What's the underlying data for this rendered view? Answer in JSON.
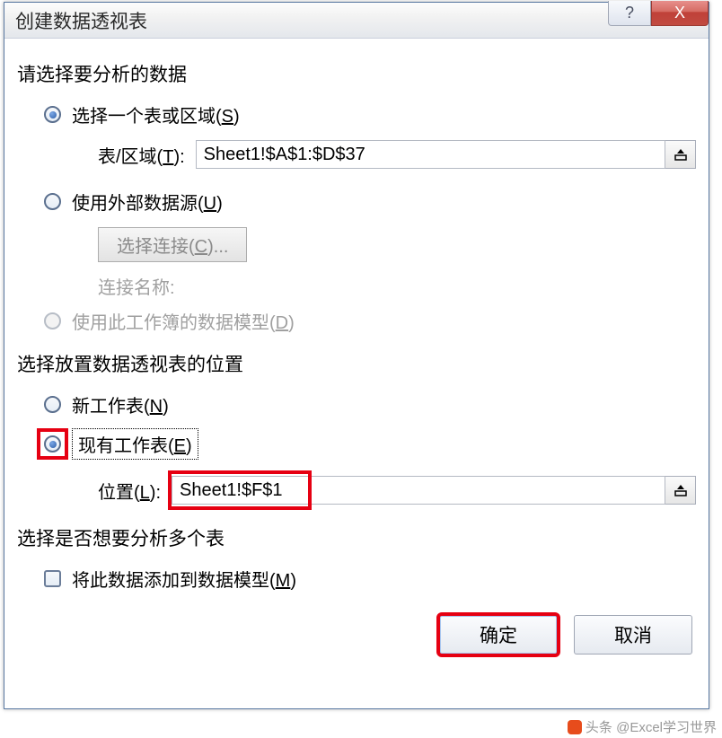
{
  "titlebar": {
    "title": "创建数据透视表",
    "help": "?",
    "close": "X"
  },
  "section1": {
    "title": "请选择要分析的数据",
    "option1": {
      "label": "选择一个表或区域(",
      "accel": "S",
      "suffix": ")"
    },
    "range_row": {
      "label_pre": "表/区域(",
      "label_accel": "T",
      "label_post": "):",
      "value": "Sheet1!$A$1:$D$37"
    },
    "option2": {
      "label": "使用外部数据源(",
      "accel": "U",
      "suffix": ")"
    },
    "choose_conn": {
      "pre": "选择连接(",
      "accel": "C",
      "post": ")..."
    },
    "conn_name_label": "连接名称:",
    "option3": {
      "label": "使用此工作簿的数据模型(",
      "accel": "D",
      "suffix": ")"
    }
  },
  "section2": {
    "title": "选择放置数据透视表的位置",
    "option1": {
      "label": "新工作表(",
      "accel": "N",
      "suffix": ")"
    },
    "option2": {
      "label": "现有工作表(",
      "accel": "E",
      "suffix": ")"
    },
    "loc_row": {
      "label_pre": "位置(",
      "label_accel": "L",
      "label_post": "):",
      "value": "Sheet1!$F$1"
    }
  },
  "section3": {
    "title": "选择是否想要分析多个表",
    "check1": {
      "label": "将此数据添加到数据模型(",
      "accel": "M",
      "suffix": ")"
    }
  },
  "actions": {
    "ok": "确定",
    "cancel": "取消"
  },
  "attribution": "头条 @Excel学习世界"
}
